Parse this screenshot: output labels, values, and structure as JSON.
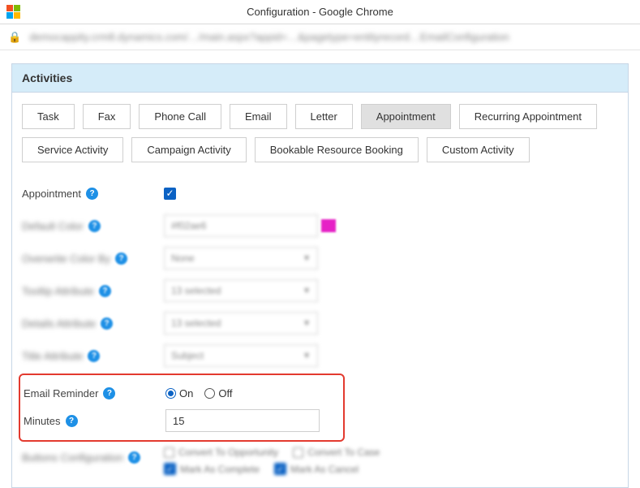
{
  "window": {
    "title": "Configuration - Google Chrome"
  },
  "addressBar": {
    "url": "democappity.crm8.dynamics.com/…/main.aspx?appid=…&pagetype=entityrecord…EmailConfiguration"
  },
  "panel": {
    "header": "Activities"
  },
  "tabs": {
    "row1": [
      "Task",
      "Fax",
      "Phone Call",
      "Email",
      "Letter",
      "Appointment",
      "Recurring Appointment"
    ],
    "row2": [
      "Service Activity",
      "Campaign Activity",
      "Bookable Resource Booking",
      "Custom Activity"
    ],
    "active": "Appointment"
  },
  "form": {
    "appointment": {
      "label": "Appointment",
      "checked": true
    },
    "defaultColor": {
      "label": "Default Color",
      "value": "#f02ae6"
    },
    "overwriteColorBy": {
      "label": "Overwrite Color By",
      "value": "None"
    },
    "tooltipAttribute": {
      "label": "Tooltip Attribute",
      "value": "13 selected"
    },
    "detailsAttribute": {
      "label": "Details Attribute",
      "value": "13 selected"
    },
    "titleAttribute": {
      "label": "Title Attribute",
      "value": "Subject"
    },
    "emailReminder": {
      "label": "Email Reminder",
      "options": {
        "on": "On",
        "off": "Off"
      },
      "selected": "on"
    },
    "minutes": {
      "label": "Minutes",
      "value": "15"
    },
    "buttonsConfig": {
      "label": "Buttons Configuration",
      "items": {
        "convertOpportunity": "Convert To Opportunity",
        "convertCase": "Convert To Case",
        "markComplete": "Mark As Complete",
        "markCancel": "Mark As Cancel"
      }
    }
  }
}
